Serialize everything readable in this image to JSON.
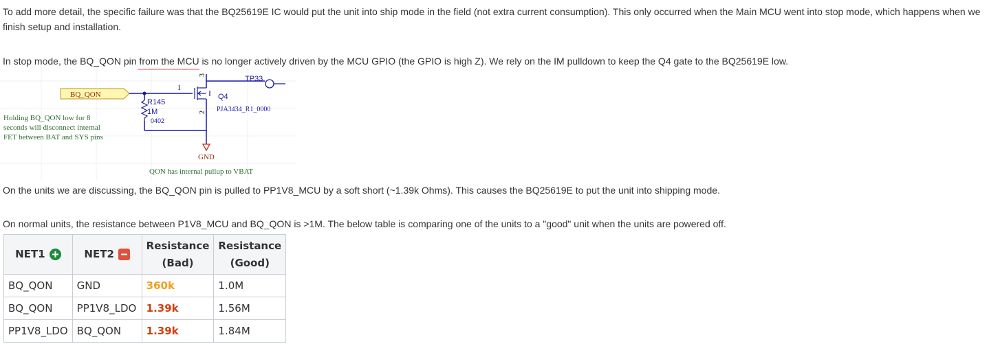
{
  "text": {
    "p1": "To add more detail, the specific failure was that the BQ25619E IC would put the unit into ship mode in the field (not extra current consumption). This only occurred when the Main MCU went into stop mode, which happens when we finish setup and installation.",
    "p2": "In stop mode, the BQ_QON pin from the MCU is no longer actively driven by the MCU GPIO (the GPIO is high Z). We rely on the IM pulldown to keep the Q4 gate to the BQ25619E low.",
    "p3": "On the units we are discussing, the BQ_QON pin is pulled to PP1V8_MCU by a soft short (~1.39k Ohms). This causes the BQ25619E to put the unit into shipping mode.",
    "p4": "On normal units, the resistance between P1V8_MCU and BQ_QON is >1M. The below table is comparing one of the units to a \"good\" unit when the units are powered off."
  },
  "schematic": {
    "net_label": "BQ_QON",
    "testpoint": "TP33",
    "resistor_ref": "R145",
    "resistor_value": "1M",
    "resistor_pkg": "0402",
    "transistor_ref": "Q4",
    "transistor_part": "PJA3434_R1_0000",
    "pin1": "1",
    "pin2": "2",
    "pin3": "3",
    "gnd": "GND",
    "note_left_1": "Holding BQ_QON low for 8",
    "note_left_2": "seconds will disconnect internal",
    "note_left_3": "FET between BAT and SYS pins",
    "note_bottom": "QON has internal pullup to VBAT"
  },
  "table": {
    "headers": {
      "net1": "NET1",
      "net2": "NET2",
      "bad_1": "Resistance",
      "bad_2": "(Bad)",
      "good_1": "Resistance",
      "good_2": "(Good)"
    },
    "rows": [
      {
        "net1": "BQ_QON",
        "net2": "GND",
        "bad": "360k",
        "good": "1.0M"
      },
      {
        "net1": "BQ_QON",
        "net2": "PP1V8_LDO",
        "bad": "1.39k",
        "good": "1.56M"
      },
      {
        "net1": "PP1V8_LDO",
        "net2": "BQ_QON",
        "bad": "1.39k",
        "good": "1.84M"
      }
    ]
  },
  "colors": {
    "plus_icon": "#1f8a3a",
    "minus_icon": "#e0503a",
    "bad_orange": "#f0a020",
    "bad_red": "#d04010",
    "wire": "#1a1aa0",
    "net_label_fill": "#fff7b0",
    "note_green": "#2c6e2c"
  }
}
